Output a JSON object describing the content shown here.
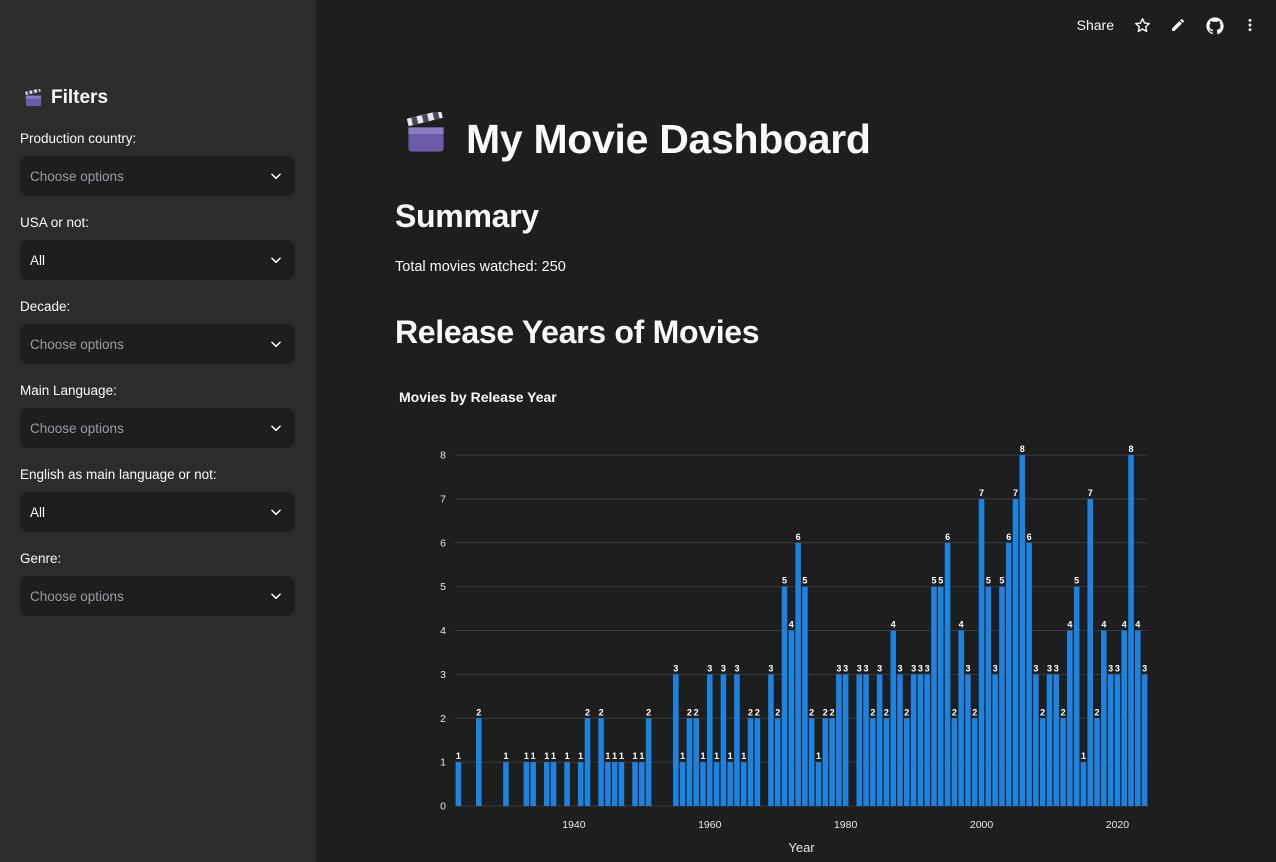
{
  "header": {
    "share_label": "Share",
    "icons": [
      "star-icon",
      "pencil-icon",
      "github-icon",
      "more-vertical-icon"
    ]
  },
  "sidebar": {
    "title": "Filters",
    "title_icon": "clapper-board-icon",
    "filters": [
      {
        "label": "Production country:",
        "value": "Choose options",
        "is_placeholder": true
      },
      {
        "label": "USA or not:",
        "value": "All",
        "is_placeholder": false
      },
      {
        "label": "Decade:",
        "value": "Choose options",
        "is_placeholder": true
      },
      {
        "label": "Main Language:",
        "value": "Choose options",
        "is_placeholder": true
      },
      {
        "label": "English as main language or not:",
        "value": "All",
        "is_placeholder": false
      },
      {
        "label": "Genre:",
        "value": "Choose options",
        "is_placeholder": true
      }
    ]
  },
  "main": {
    "title": "My Movie Dashboard",
    "title_icon": "clapper-board-icon",
    "summary_heading": "Summary",
    "summary_text": "Total movies watched: 250",
    "release_heading": "Release Years of Movies"
  },
  "colors": {
    "bar": "#1c83e1",
    "background": "#1e1e1e",
    "sidebar": "#2c2c2b",
    "grid": "#3a3a3a"
  },
  "chart_data": {
    "type": "bar",
    "title": "Movies by Release Year",
    "xlabel": "Year",
    "ylabel": "",
    "ylim": [
      0,
      8
    ],
    "xlim": [
      1922.5,
      2024.5
    ],
    "grid": true,
    "x_ticks": [
      1940,
      1960,
      1980,
      2000,
      2020
    ],
    "y_ticks": [
      0,
      1,
      2,
      3,
      4,
      5,
      6,
      7,
      8
    ],
    "x": [
      1923,
      1926,
      1930,
      1933,
      1934,
      1936,
      1937,
      1939,
      1941,
      1942,
      1944,
      1945,
      1946,
      1947,
      1949,
      1950,
      1951,
      1955,
      1956,
      1957,
      1958,
      1959,
      1960,
      1961,
      1962,
      1963,
      1964,
      1965,
      1966,
      1967,
      1969,
      1970,
      1971,
      1972,
      1973,
      1974,
      1975,
      1976,
      1977,
      1978,
      1979,
      1980,
      1982,
      1983,
      1984,
      1985,
      1986,
      1987,
      1988,
      1989,
      1990,
      1991,
      1992,
      1993,
      1994,
      1995,
      1996,
      1997,
      1998,
      1999,
      2000,
      2001,
      2002,
      2003,
      2004,
      2005,
      2006,
      2007,
      2008,
      2009,
      2010,
      2011,
      2012,
      2013,
      2014,
      2015,
      2016,
      2017,
      2018,
      2019,
      2020,
      2021,
      2022,
      2023,
      2024
    ],
    "values": [
      1,
      2,
      1,
      1,
      1,
      1,
      1,
      1,
      1,
      2,
      2,
      1,
      1,
      1,
      1,
      1,
      2,
      3,
      1,
      2,
      2,
      1,
      3,
      1,
      3,
      1,
      3,
      1,
      2,
      2,
      3,
      2,
      5,
      4,
      6,
      5,
      2,
      1,
      2,
      2,
      3,
      3,
      3,
      3,
      2,
      3,
      2,
      4,
      3,
      2,
      3,
      3,
      3,
      5,
      5,
      6,
      2,
      4,
      3,
      2,
      7,
      5,
      3,
      5,
      6,
      7,
      8,
      6,
      3,
      2,
      3,
      3,
      2,
      4,
      5,
      1,
      7,
      2,
      4,
      3,
      3,
      4,
      8,
      4,
      3
    ]
  }
}
